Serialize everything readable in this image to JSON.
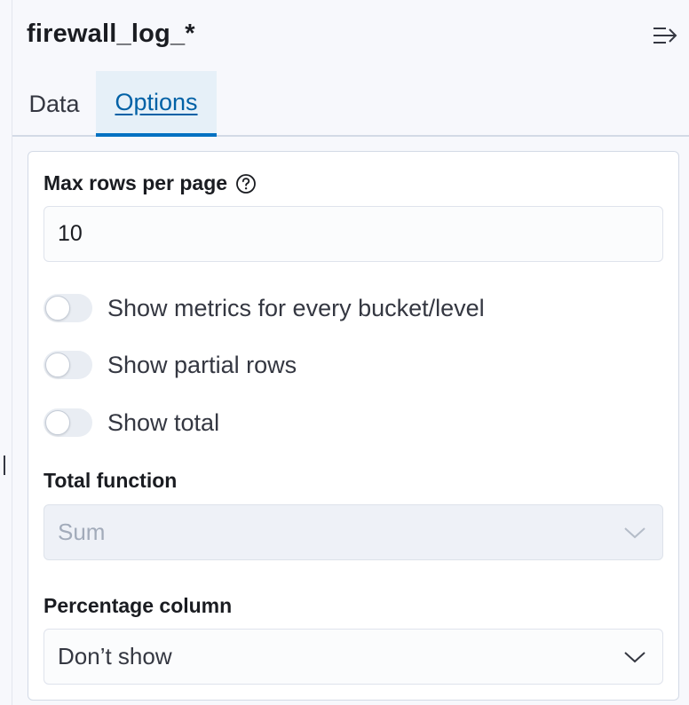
{
  "header": {
    "title": "firewall_log_*",
    "collapse_icon": "collapse-right-arrow-icon"
  },
  "tabs": [
    {
      "label": "Data",
      "selected": false
    },
    {
      "label": "Options",
      "selected": true
    }
  ],
  "options": {
    "max_rows": {
      "label": "Max rows per page",
      "help_icon": "question-circle-icon",
      "value": "10"
    },
    "switches": [
      {
        "label": "Show metrics for every bucket/level",
        "checked": false
      },
      {
        "label": "Show partial rows",
        "checked": false
      },
      {
        "label": "Show total",
        "checked": false
      }
    ],
    "total_function": {
      "label": "Total function",
      "value": "Sum",
      "disabled": true
    },
    "percentage_column": {
      "label": "Percentage column",
      "value": "Don’t show",
      "disabled": false
    }
  },
  "colors": {
    "accent": "#0071c2",
    "tab_selected_bg": "#e6f0f8",
    "switch_off": "#e9edf3"
  }
}
